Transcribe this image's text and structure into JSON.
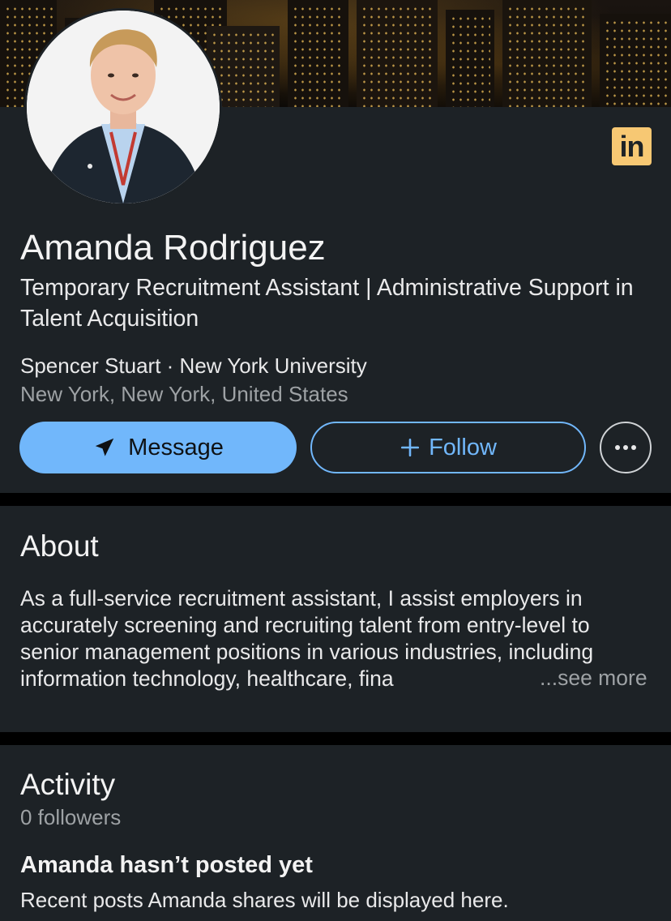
{
  "profile": {
    "name": "Amanda Rodriguez",
    "headline": "Temporary Recruitment Assistant | Administrative Support in Talent Acquisition",
    "orgs": "Spencer Stuart · New York University",
    "location": "New York, New York, United States",
    "badge_text": "in",
    "avatar_icon": "profile-photo"
  },
  "actions": {
    "message_label": "Message",
    "message_icon": "send-icon",
    "follow_label": "Follow",
    "follow_icon": "plus-icon",
    "more_icon": "more-horizontal-icon"
  },
  "about": {
    "title": "About",
    "text": "As a full-service recruitment assistant, I assist employers in accurately screening and recruiting talent from entry-level to senior management positions in various industries, including information technology, healthcare, fina",
    "see_more": "...see more"
  },
  "activity": {
    "title": "Activity",
    "followers": "0 followers",
    "empty_title": "Amanda hasn’t posted yet",
    "empty_text": "Recent posts Amanda shares will be displayed here."
  },
  "colors": {
    "background": "#000000",
    "card": "#1d2226",
    "accent": "#71b7fb",
    "linkedin_badge": "#f7c873",
    "muted_text": "#9ea2a5"
  }
}
